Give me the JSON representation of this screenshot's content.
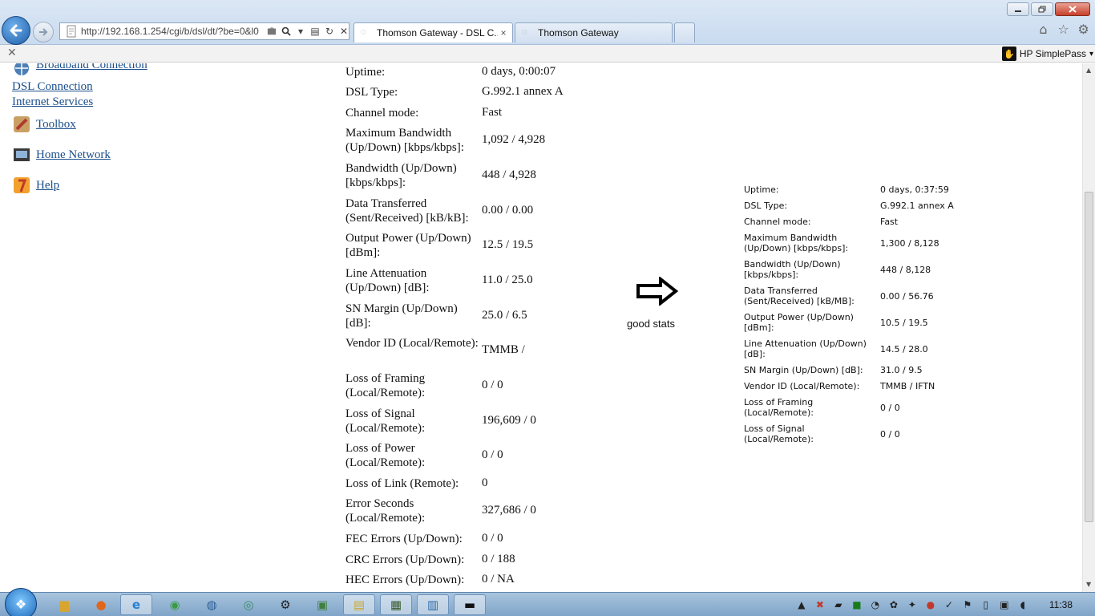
{
  "browser": {
    "url": "http://192.168.1.254/cgi/b/dsl/dt/?be=0&l0",
    "tabs": [
      {
        "label": "Thomson Gateway - DSL C...",
        "close": "×"
      },
      {
        "label": "Thomson Gateway"
      }
    ],
    "simplepass_label": "HP SimplePass"
  },
  "sidenav": {
    "items": [
      {
        "label": "Broadband Connection"
      },
      {
        "label": "DSL Connection"
      },
      {
        "label": "Internet Services"
      },
      {
        "label": "Toolbox"
      },
      {
        "label": "Home Network"
      },
      {
        "label": "Help"
      }
    ]
  },
  "dsl_stats": [
    {
      "label": "Uptime:",
      "value": "0 days, 0:00:07"
    },
    {
      "label": "DSL Type:",
      "value": "G.992.1 annex A"
    },
    {
      "label": "Channel mode:",
      "value": "Fast"
    },
    {
      "label": "Maximum Bandwidth (Up/Down) [kbps/kbps]:",
      "value": "1,092 / 4,928"
    },
    {
      "label": "Bandwidth (Up/Down) [kbps/kbps]:",
      "value": "448 / 4,928"
    },
    {
      "label": "Data Transferred (Sent/Received) [kB/kB]:",
      "value": "0.00 / 0.00"
    },
    {
      "label": "Output Power (Up/Down) [dBm]:",
      "value": "12.5 / 19.5"
    },
    {
      "label": "Line Attenuation (Up/Down) [dB]:",
      "value": "11.0 / 25.0"
    },
    {
      "label": "SN Margin (Up/Down) [dB]:",
      "value": "25.0 / 6.5"
    },
    {
      "label": "Vendor ID (Local/Remote):",
      "value": "TMMB /"
    },
    {
      "label": "Loss of Framing (Local/Remote):",
      "value": "0 / 0"
    },
    {
      "label": "Loss of Signal (Local/Remote):",
      "value": "196,609 / 0"
    },
    {
      "label": "Loss of Power (Local/Remote):",
      "value": "0 / 0"
    },
    {
      "label": "Loss of Link (Remote):",
      "value": "0"
    },
    {
      "label": "Error Seconds (Local/Remote):",
      "value": "327,686 / 0"
    },
    {
      "label": "FEC Errors (Up/Down):",
      "value": "0 / 0"
    },
    {
      "label": "CRC Errors (Up/Down):",
      "value": "0 / 188"
    },
    {
      "label": "HEC Errors (Up/Down):",
      "value": "0 / NA"
    }
  ],
  "annotation": {
    "text": "good stats"
  },
  "good_stats": [
    {
      "label": "Uptime:",
      "value": "0 days, 0:37:59"
    },
    {
      "label": "DSL Type:",
      "value": "G.992.1 annex A"
    },
    {
      "label": "Channel mode:",
      "value": "Fast"
    },
    {
      "label": "Maximum Bandwidth (Up/Down) [kbps/kbps]:",
      "value": "1,300 / 8,128"
    },
    {
      "label": "Bandwidth (Up/Down) [kbps/kbps]:",
      "value": "448 / 8,128"
    },
    {
      "label": "Data Transferred (Sent/Received) [kB/MB]:",
      "value": "0.00 / 56.76"
    },
    {
      "label": "Output Power (Up/Down) [dBm]:",
      "value": "10.5 / 19.5"
    },
    {
      "label": "Line Attenuation (Up/Down) [dB]:",
      "value": "14.5 / 28.0"
    },
    {
      "label": "SN Margin (Up/Down) [dB]:",
      "value": "31.0 / 9.5"
    },
    {
      "label": "Vendor ID (Local/Remote):",
      "value": "TMMB / IFTN"
    },
    {
      "label": "Loss of Framing (Local/Remote):",
      "value": "0 / 0"
    },
    {
      "label": "Loss of Signal (Local/Remote):",
      "value": "0 / 0"
    }
  ],
  "taskbar": {
    "clock": "11:38"
  },
  "colors": {
    "link": "#1a4e8a",
    "taskbar": "#8fb0d2"
  }
}
